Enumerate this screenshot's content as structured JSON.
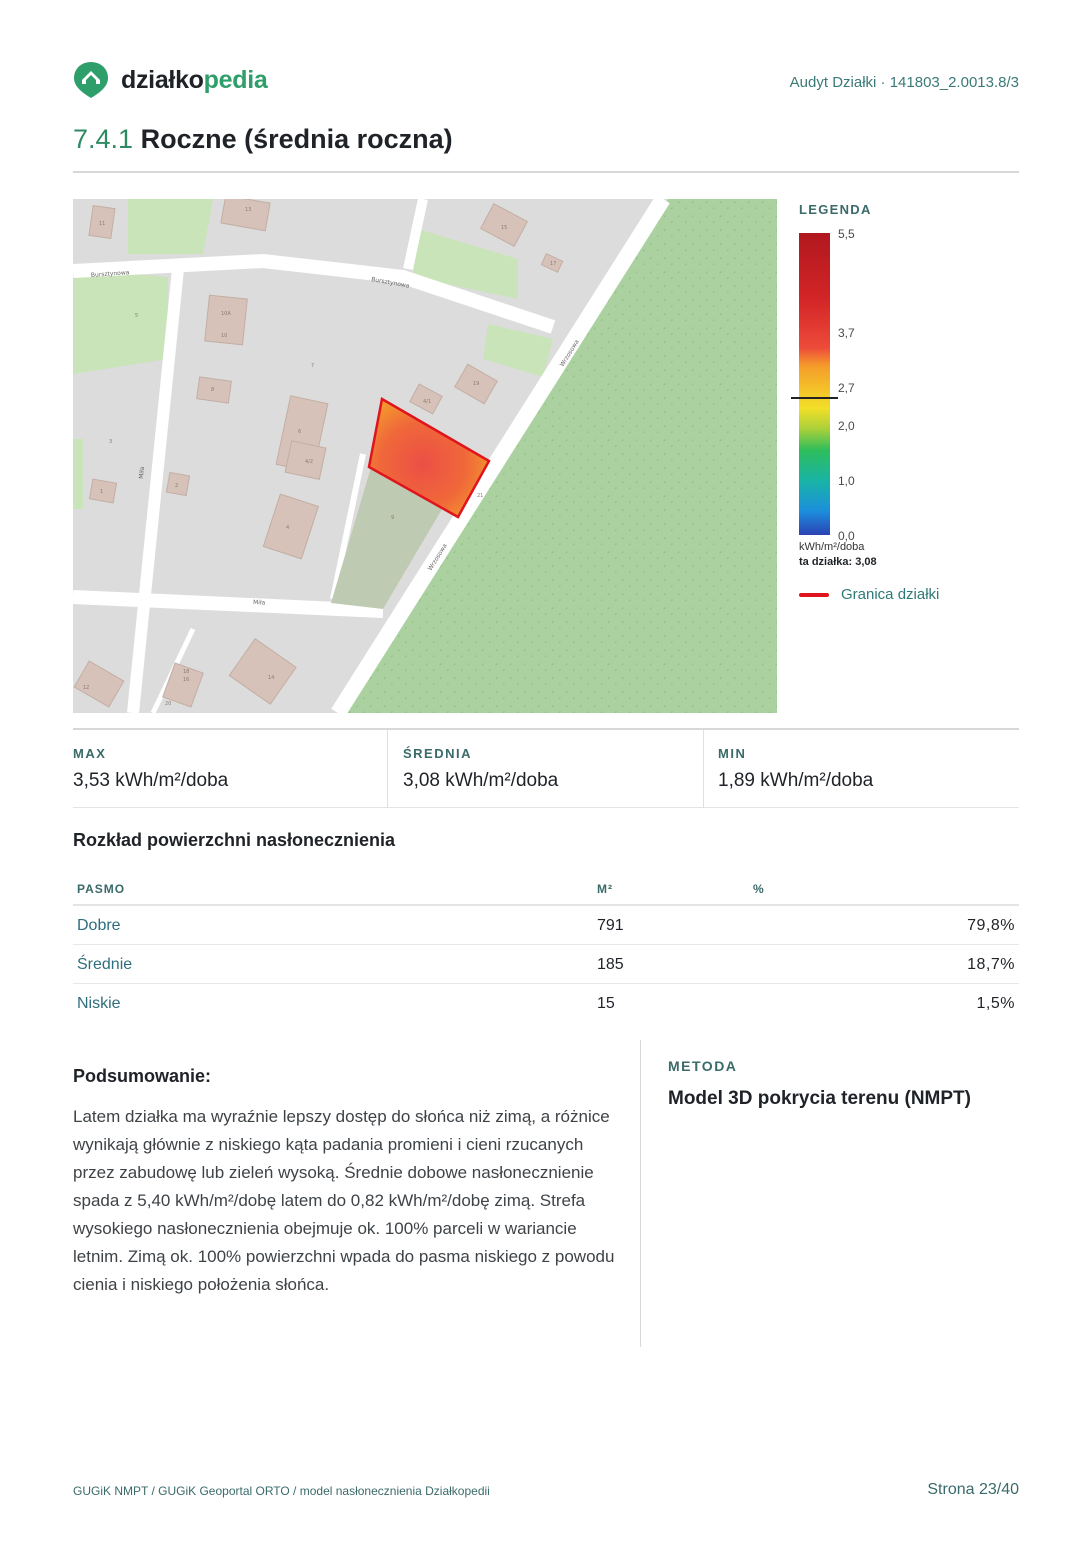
{
  "header": {
    "logo_part1": "działko",
    "logo_part2": "pedia",
    "doc_ref": "Audyt Działki · 141803_2.0013.8/3"
  },
  "title": {
    "number": "7.4.1",
    "text": "Roczne (średnia roczna)"
  },
  "map": {
    "streets": [
      "Bursztynowa",
      "Bursztynowa",
      "Wrzosowa",
      "Wrzosowa",
      "Miła",
      "Miła"
    ],
    "house_numbers": [
      "11",
      "13",
      "15",
      "17",
      "19",
      "10",
      "10A",
      "8",
      "6",
      "4",
      "2",
      "12",
      "14",
      "1",
      "3",
      "5",
      "7",
      "9",
      "16",
      "18",
      "20",
      "4/1",
      "4/2",
      "21"
    ],
    "parcel_color": "#e0141c"
  },
  "legend": {
    "title": "LEGENDA",
    "ticks": [
      "5,5",
      "3,7",
      "2,7",
      "2,0",
      "1,0",
      "0,0"
    ],
    "unit": "kWh/m²/doba",
    "this_parcel": "ta działka: 3,08",
    "marker_value": 3.08,
    "boundary_label": "Granica działki"
  },
  "stats": {
    "max_label": "MAX",
    "max_value": "3,53 kWh/m²/doba",
    "avg_label": "ŚREDNIA",
    "avg_value": "3,08 kWh/m²/doba",
    "min_label": "MIN",
    "min_value": "1,89 kWh/m²/doba"
  },
  "distribution": {
    "heading": "Rozkład powierzchni nasłonecznienia",
    "col_band": "PASMO",
    "col_m2": "M²",
    "col_pct": "%",
    "rows": [
      {
        "band": "Dobre",
        "m2": "791",
        "pct": "79,8%"
      },
      {
        "band": "Średnie",
        "m2": "185",
        "pct": "18,7%"
      },
      {
        "band": "Niskie",
        "m2": "15",
        "pct": "1,5%"
      }
    ]
  },
  "summary": {
    "title": "Podsumowanie:",
    "text": "Latem działka ma wyraźnie lepszy dostęp do słońca niż zimą, a różnice wynikają głównie z niskiego kąta padania promieni i cieni rzucanych przez zabudowę lub zieleń wysoką. Średnie dobowe nasłonecznienie spada z 5,40 kWh/m²/dobę latem do 0,82 kWh/m²/dobę zimą. Strefa wysokiego nasłonecznienia obejmuje ok. 100% parceli w wariancie letnim. Zimą ok. 100% powierzchni wpada do pasma niskiego z powodu cienia i niskiego położenia słońca."
  },
  "method": {
    "label": "METODA",
    "value": "Model 3D pokrycia terenu (NMPT)"
  },
  "footer": {
    "sources": "GUGiK NMPT / GUGiK Geoportal ORTO / model nasłonecznienia Działkopedii",
    "page": "Strona 23/40"
  }
}
